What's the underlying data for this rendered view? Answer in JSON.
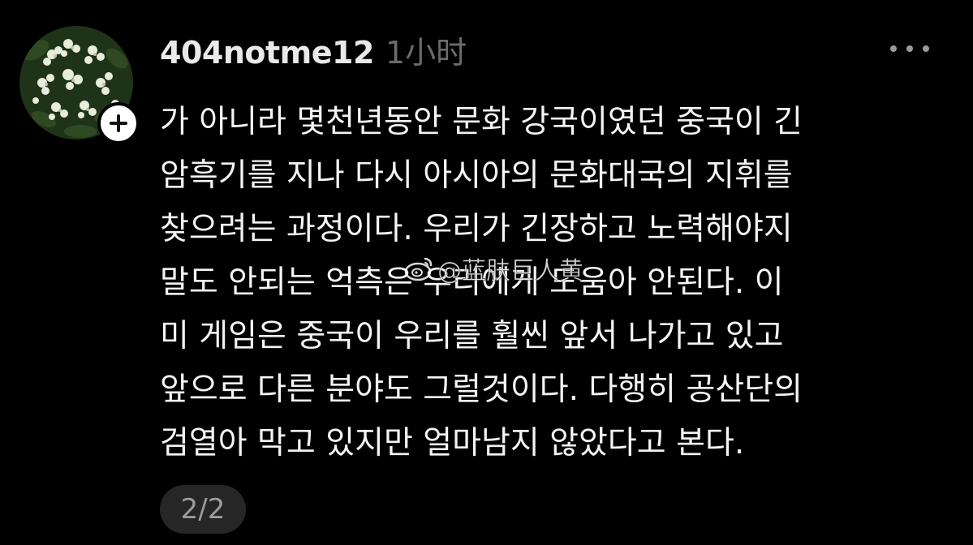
{
  "comment": {
    "username": "404notme12",
    "timestamp": "1小时",
    "body_lines": [
      "가 아니라 몇천년동안 문화 강국이였던 중국이 긴",
      "암흑기를 지나 다시 아시아의 문화대국의 지휘를",
      "찾으려는 과정이다. 우리가 긴장하고 노력해야지",
      "말도 안되는 억측은 우리에게 도움아 안된다. 이",
      "미 게임은 중국이 우리를 훨씬 앞서 나가고 있고",
      "앞으로 다른 분야도 그럴것이다. 다행히 공산단의",
      "검열아 막고 있지만 얼마남지 않았다고 본다."
    ],
    "page_indicator": "2/2"
  },
  "avatar": {
    "icon": "flower-bouquet-avatar"
  },
  "actions": {
    "follow_icon": "plus-icon",
    "more_icon": "more-horizontal-icon"
  },
  "watermark": {
    "text": "@蓝肤巨人黄",
    "icon": "weibo-icon"
  },
  "colors": {
    "background": "#000000",
    "text_primary": "#f4f4f4",
    "text_secondary": "#6b6b6b",
    "badge_bg": "#262626"
  }
}
